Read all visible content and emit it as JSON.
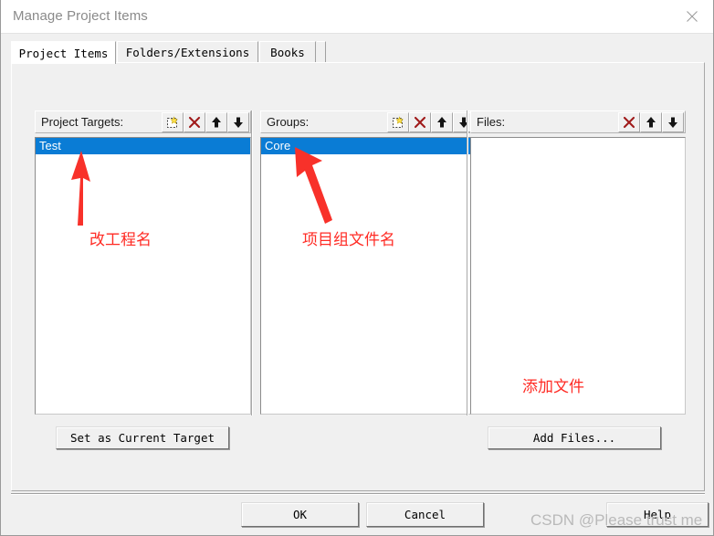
{
  "window": {
    "title": "Manage Project Items",
    "close_icon": "close-icon"
  },
  "tabs": [
    {
      "label": "Project Items",
      "active": true
    },
    {
      "label": "Folders/Extensions",
      "active": false
    },
    {
      "label": "Books",
      "active": false
    }
  ],
  "columns": {
    "targets": {
      "label": "Project Targets:",
      "buttons": [
        "new-item-icon",
        "delete-icon",
        "move-up-icon",
        "move-down-icon"
      ],
      "items": [
        {
          "label": "Test",
          "selected": true
        }
      ],
      "action_button": "Set as Current Target"
    },
    "groups": {
      "label": "Groups:",
      "buttons": [
        "new-item-icon",
        "delete-icon",
        "move-up-icon",
        "move-down-icon"
      ],
      "items": [
        {
          "label": "Core",
          "selected": true
        }
      ]
    },
    "files": {
      "label": "Files:",
      "buttons": [
        "delete-icon",
        "move-up-icon",
        "move-down-icon"
      ],
      "items": [],
      "action_button": "Add Files..."
    }
  },
  "dialog_buttons": {
    "ok": "OK",
    "cancel": "Cancel",
    "help": "Help"
  },
  "annotations": [
    {
      "text": "改工程名"
    },
    {
      "text": "项目组文件名"
    },
    {
      "text": "添加文件"
    }
  ],
  "watermark": "CSDN @Please trust me",
  "colors": {
    "selection": "#0a7cd5",
    "annotation": "#ff2b24",
    "delete_icon": "#a01a1a",
    "dialog_face": "#f0f0f0"
  }
}
